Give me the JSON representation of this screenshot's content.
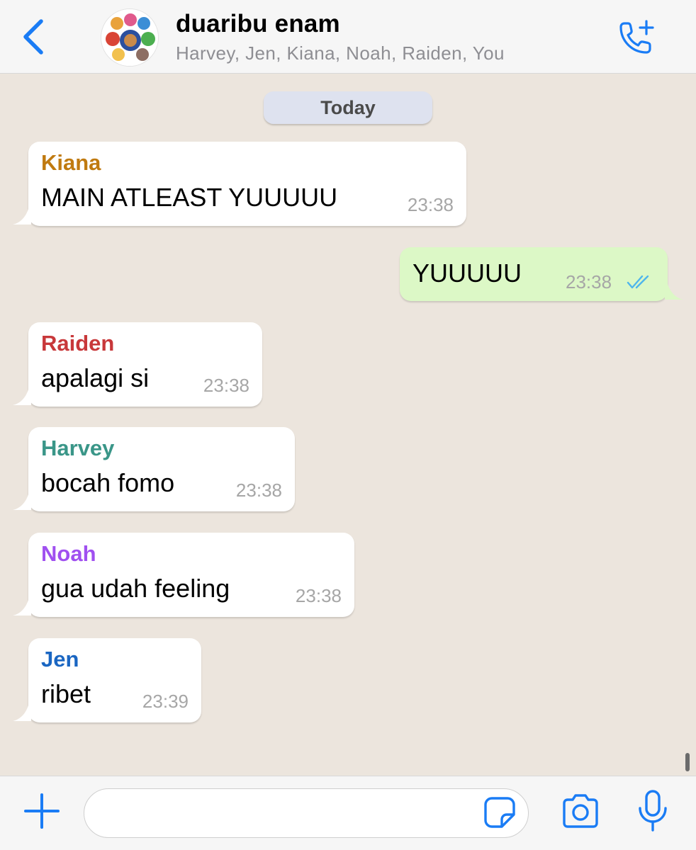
{
  "header": {
    "title": "duaribu enam",
    "members": "Harvey, Jen, Kiana, Noah, Raiden, You"
  },
  "chat": {
    "date_separator": "Today",
    "messages": [
      {
        "sender": "Kiana",
        "sender_color": "#c07a10",
        "text": "MAIN ATLEAST YUUUUU",
        "time": "23:38",
        "outgoing": false
      },
      {
        "sender": "",
        "text": "YUUUUU",
        "time": "23:38",
        "outgoing": true,
        "status": "read"
      },
      {
        "sender": "Raiden",
        "sender_color": "#c8383a",
        "text": "apalagi si",
        "time": "23:38",
        "outgoing": false
      },
      {
        "sender": "Harvey",
        "sender_color": "#3a9688",
        "text": "bocah fomo",
        "time": "23:38",
        "outgoing": false
      },
      {
        "sender": "Noah",
        "sender_color": "#a050f0",
        "text": "gua udah feeling",
        "time": "23:38",
        "outgoing": false
      },
      {
        "sender": "Jen",
        "sender_color": "#1a66c2",
        "text": "ribet",
        "time": "23:39",
        "outgoing": false
      }
    ]
  },
  "input": {
    "value": "",
    "placeholder": ""
  },
  "icons": {
    "back": "chevron-left-icon",
    "call": "phone-add-icon",
    "plus": "plus-icon",
    "sticker": "sticker-icon",
    "camera": "camera-icon",
    "mic": "microphone-icon"
  },
  "colors": {
    "accent": "#1a7cf5",
    "chat_background": "#ece5dd",
    "outgoing_bubble": "#dcf8c6",
    "incoming_bubble": "#ffffff",
    "read_ticks": "#4fb6ec"
  }
}
